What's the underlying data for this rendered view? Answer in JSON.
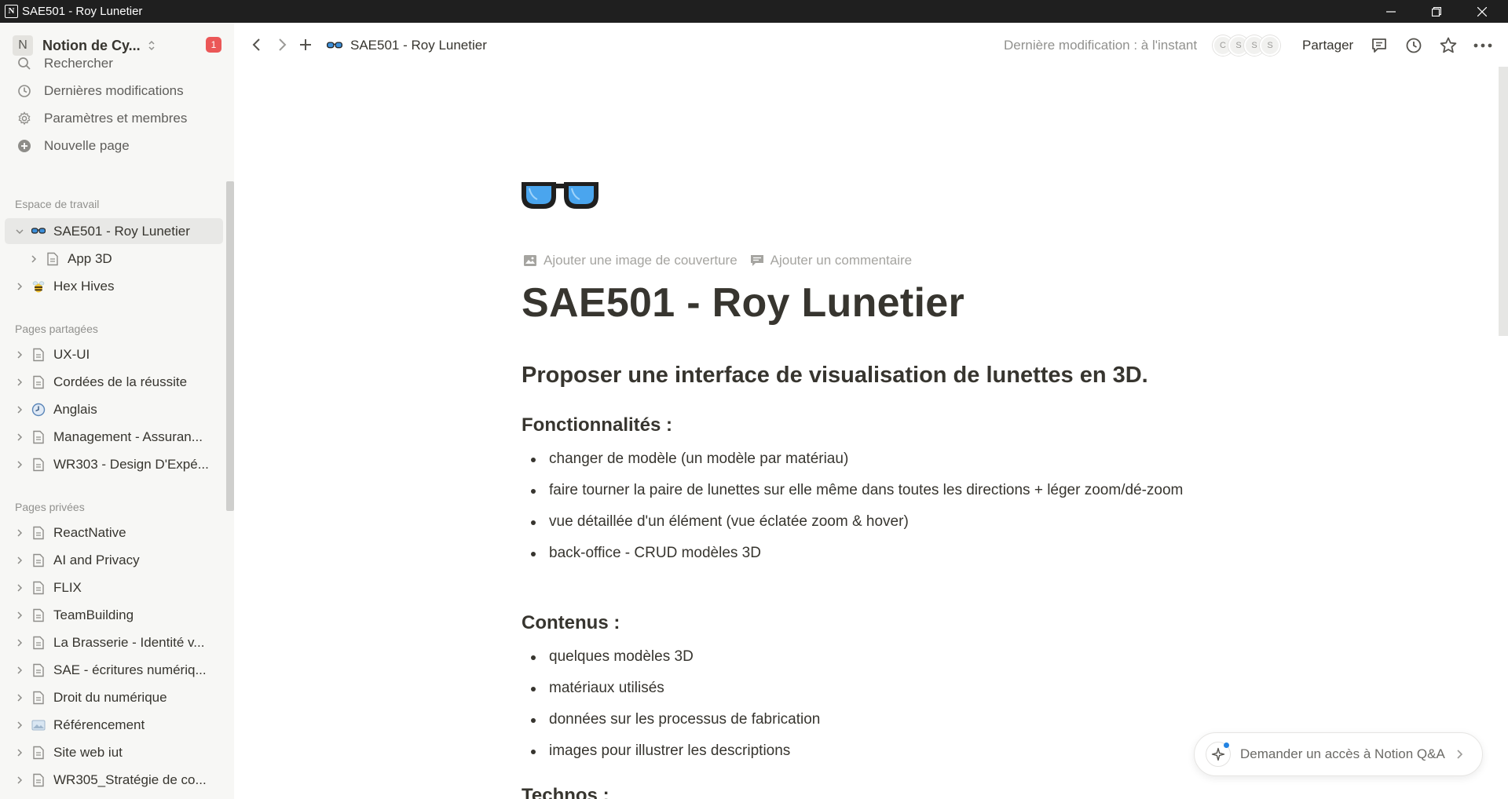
{
  "window": {
    "title": "SAE501 - Roy Lunetier",
    "app_icon_letter": "N"
  },
  "sidebar": {
    "workspace_initial": "N",
    "workspace_name": "Notion de Cy...",
    "notification_count": "1",
    "nav": [
      {
        "label": "Rechercher",
        "icon": "search-icon"
      },
      {
        "label": "Dernières modifications",
        "icon": "clock-icon"
      },
      {
        "label": "Paramètres et membres",
        "icon": "gear-icon"
      },
      {
        "label": "Nouvelle page",
        "icon": "plus-circle-icon"
      }
    ],
    "workspace_section_label": "Espace de travail",
    "workspace_pages": [
      {
        "label": "SAE501 - Roy Lunetier",
        "icon": "glasses-emoji",
        "expanded": true,
        "active": true
      },
      {
        "label": "App 3D",
        "icon": "page-icon",
        "child": true
      },
      {
        "label": "Hex Hives",
        "icon": "bee-emoji"
      }
    ],
    "shared_section_label": "Pages partagées",
    "shared_pages": [
      {
        "label": "UX-UI",
        "icon": "page-icon"
      },
      {
        "label": "Cordées de la réussite",
        "icon": "page-icon"
      },
      {
        "label": "Anglais",
        "icon": "clock-emoji"
      },
      {
        "label": "Management - Assuran...",
        "icon": "page-icon"
      },
      {
        "label": "WR303 - Design D'Expé...",
        "icon": "page-icon"
      }
    ],
    "private_section_label": "Pages privées",
    "private_pages": [
      {
        "label": "ReactNative",
        "icon": "page-icon"
      },
      {
        "label": "AI and Privacy",
        "icon": "page-icon"
      },
      {
        "label": "FLIX",
        "icon": "page-icon"
      },
      {
        "label": "TeamBuilding",
        "icon": "page-icon"
      },
      {
        "label": "La Brasserie - Identité v...",
        "icon": "page-icon"
      },
      {
        "label": "SAE - écritures numériq...",
        "icon": "page-icon"
      },
      {
        "label": "Droit du numérique",
        "icon": "page-icon"
      },
      {
        "label": "Référencement",
        "icon": "image-emoji"
      },
      {
        "label": "Site web iut",
        "icon": "page-icon"
      },
      {
        "label": "WR305_Stratégie de co...",
        "icon": "page-icon"
      }
    ]
  },
  "topbar": {
    "breadcrumb": "SAE501 - Roy Lunetier",
    "last_edited": "Dernière modification : à l'instant",
    "avatars": [
      "C",
      "S",
      "S",
      "S"
    ],
    "share_label": "Partager"
  },
  "page": {
    "icon": "glasses-emoji",
    "add_cover_label": "Ajouter une image de couverture",
    "add_comment_label": "Ajouter un commentaire",
    "title": "SAE501 - Roy Lunetier",
    "subtitle": "Proposer une interface de visualisation de lunettes en 3D.",
    "sections": [
      {
        "heading": "Fonctionnalités :",
        "items": [
          "changer de modèle (un modèle par matériau)",
          "faire tourner la paire de lunettes sur elle même dans toutes les directions + léger zoom/dé-zoom",
          "vue détaillée d'un élément (vue éclatée zoom & hover)",
          "back-office - CRUD modèles 3D"
        ]
      },
      {
        "heading": "Contenus :",
        "items": [
          "quelques modèles 3D",
          "matériaux utilisés",
          "données sur les processus de fabrication",
          "images pour illustrer les descriptions"
        ]
      }
    ],
    "next_heading_partial": "Technos :"
  },
  "qa_button": {
    "label": "Demander un accès à Notion Q&A"
  },
  "colors": {
    "sidebar_bg": "#f7f7f5",
    "text": "#37352f",
    "muted": "#91918e",
    "badge": "#eb5757",
    "accent": "#2383e2"
  }
}
